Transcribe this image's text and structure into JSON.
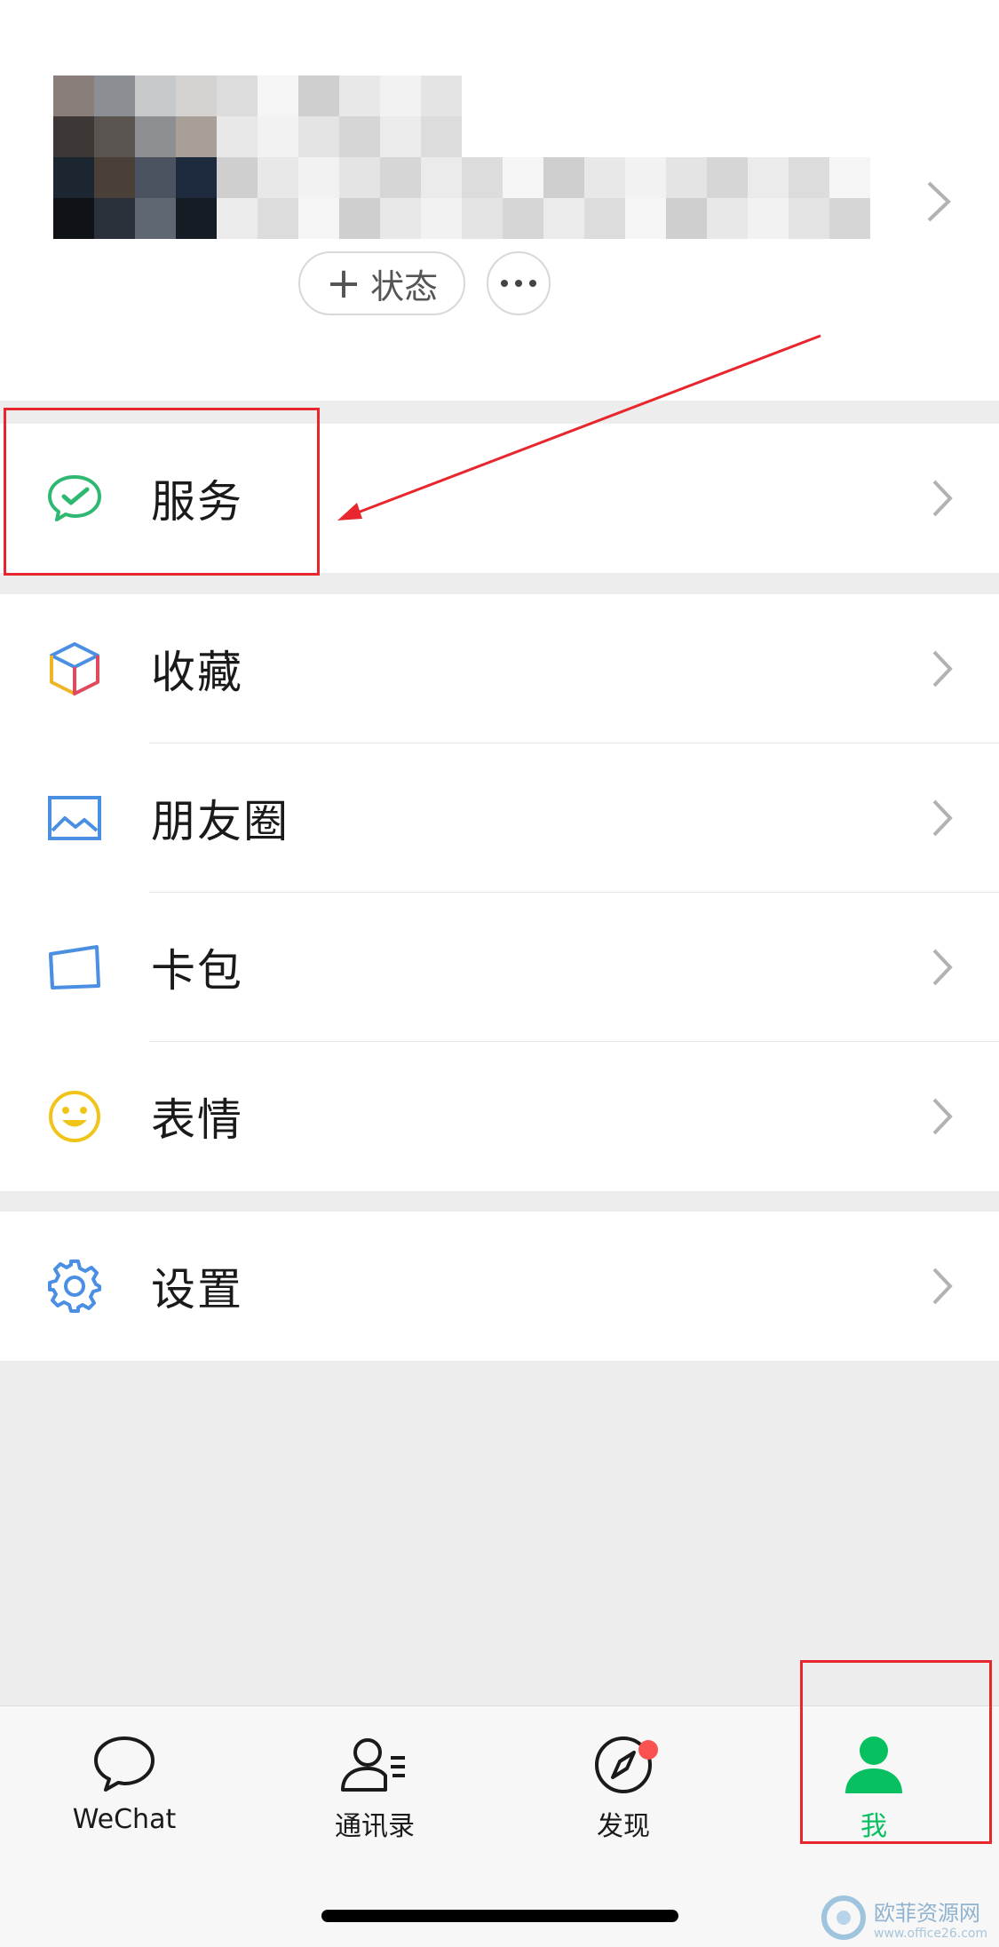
{
  "profile": {
    "status_button_label": "状态",
    "status_plus": "+"
  },
  "menu": {
    "services": {
      "label": "服务",
      "icon": "wechat-pay-icon"
    },
    "favorites": {
      "label": "收藏",
      "icon": "cube-icon"
    },
    "moments": {
      "label": "朋友圈",
      "icon": "picture-icon"
    },
    "cards": {
      "label": "卡包",
      "icon": "card-icon"
    },
    "stickers": {
      "label": "表情",
      "icon": "smiley-icon"
    },
    "settings": {
      "label": "设置",
      "icon": "gear-icon"
    }
  },
  "tabbar": {
    "tabs": [
      {
        "label": "WeChat",
        "icon": "chat-bubble-icon"
      },
      {
        "label": "通讯录",
        "icon": "contacts-icon"
      },
      {
        "label": "发现",
        "icon": "compass-icon"
      },
      {
        "label": "我",
        "icon": "person-icon"
      }
    ],
    "active_index": 3
  },
  "watermark": {
    "title": "欧菲资源网",
    "url": "www.office26.com"
  },
  "colors": {
    "accent_green": "#07c160",
    "annotation_red": "#e8262d",
    "badge_red": "#fa5151"
  }
}
